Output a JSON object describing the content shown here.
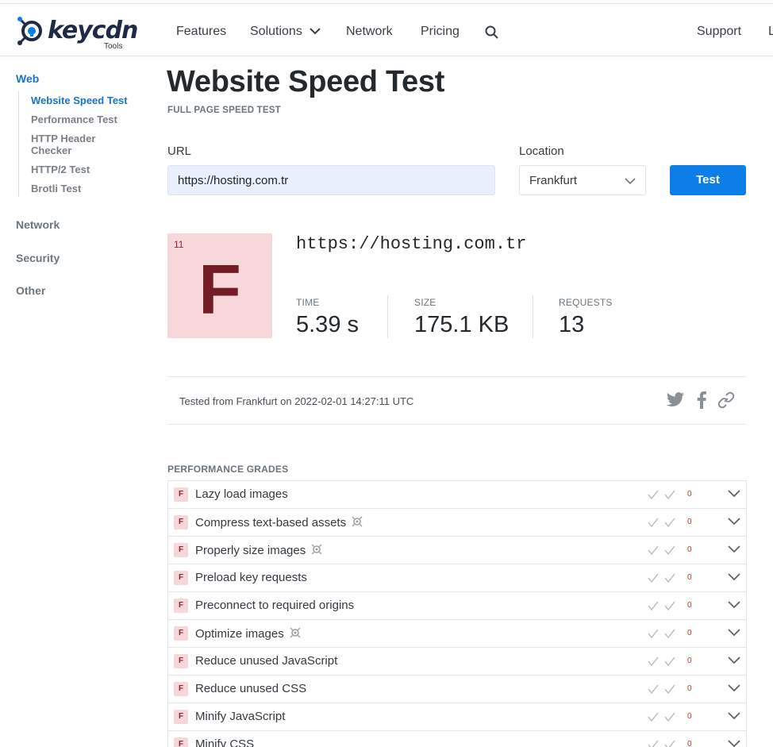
{
  "brand": {
    "name": "keycdn",
    "sub": "Tools",
    "accent": "#0d7ee8"
  },
  "nav": {
    "items": [
      "Features",
      "Solutions",
      "Network",
      "Pricing"
    ],
    "right": [
      "Support",
      "L"
    ]
  },
  "sidebar": {
    "web": "Web",
    "web_items": [
      "Website Speed Test",
      "Performance Test",
      "HTTP Header Checker",
      "HTTP/2 Test",
      "Brotli Test"
    ],
    "sections": [
      "Network",
      "Security",
      "Other"
    ]
  },
  "main": {
    "title": "Website Speed Test",
    "subtitle": "FULL PAGE SPEED TEST",
    "url_label": "URL",
    "url_value": "https://hosting.com.tr",
    "location_label": "Location",
    "location_value": "Frankfurt",
    "test_button": "Test"
  },
  "result": {
    "grade_score": "11",
    "grade_letter": "F",
    "url": "https://hosting.com.tr",
    "stats": [
      {
        "label": "TIME",
        "value": "5.39 s"
      },
      {
        "label": "SIZE",
        "value": "175.1 KB"
      },
      {
        "label": "REQUESTS",
        "value": "13"
      }
    ],
    "tested_from": "Tested from Frankfurt on 2022-02-01 14:27:11 UTC"
  },
  "grades": {
    "title": "PERFORMANCE GRADES",
    "rows": [
      {
        "grade": "F",
        "label": "Lazy load images",
        "marker": false,
        "count": "0"
      },
      {
        "grade": "F",
        "label": "Compress text-based assets",
        "marker": true,
        "count": "0"
      },
      {
        "grade": "F",
        "label": "Properly size images",
        "marker": true,
        "count": "0"
      },
      {
        "grade": "F",
        "label": "Preload key requests",
        "marker": false,
        "count": "0"
      },
      {
        "grade": "F",
        "label": "Preconnect to required origins",
        "marker": false,
        "count": "0"
      },
      {
        "grade": "F",
        "label": "Optimize images",
        "marker": true,
        "count": "0"
      },
      {
        "grade": "F",
        "label": "Reduce unused JavaScript",
        "marker": false,
        "count": "0"
      },
      {
        "grade": "F",
        "label": "Reduce unused CSS",
        "marker": false,
        "count": "0"
      },
      {
        "grade": "F",
        "label": "Minify JavaScript",
        "marker": false,
        "count": "0"
      },
      {
        "grade": "F",
        "label": "Minify CSS",
        "marker": false,
        "count": "0"
      }
    ]
  }
}
